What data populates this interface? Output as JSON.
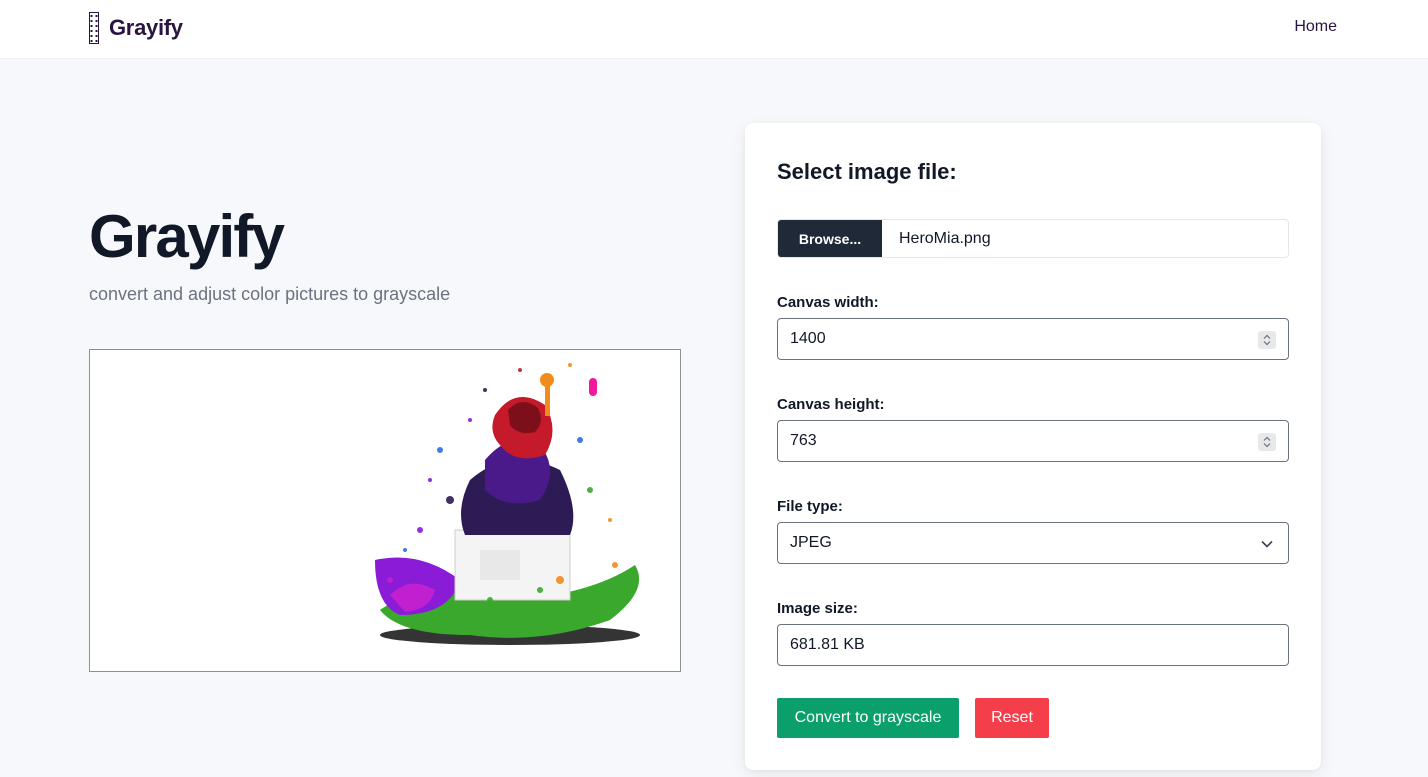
{
  "navbar": {
    "brand": "Grayify",
    "brand_icon": "film-strip-icon",
    "home_label": "Home"
  },
  "hero": {
    "title": "Grayify",
    "subtitle": "convert and adjust color pictures to grayscale"
  },
  "preview": {
    "image_description_icon": "splash-art-image"
  },
  "form": {
    "title": "Select image file:",
    "browse_label": "Browse...",
    "file_name": "HeroMia.png",
    "canvas_width_label": "Canvas width:",
    "canvas_width_value": "1400",
    "canvas_height_label": "Canvas height:",
    "canvas_height_value": "763",
    "file_type_label": "File type:",
    "file_type_value": "JPEG",
    "image_size_label": "Image size:",
    "image_size_value": "681.81 KB",
    "convert_label": "Convert to grayscale",
    "reset_label": "Reset"
  },
  "colors": {
    "brand": "#2a1540",
    "convert": "#0a9f6b",
    "reset": "#f43f4b",
    "browse": "#1f2937"
  }
}
